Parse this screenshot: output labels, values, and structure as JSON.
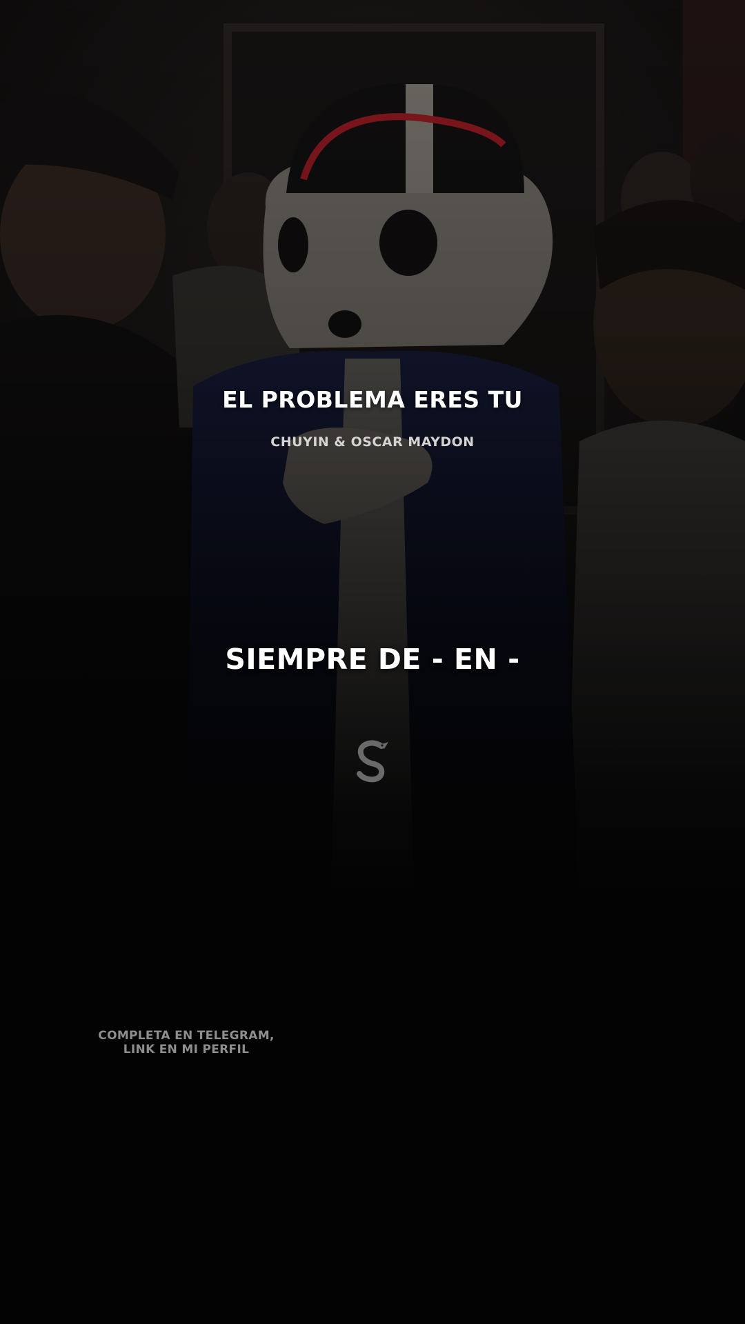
{
  "song": {
    "title": "EL PROBLEMA ERES TU",
    "artist": "CHUYIN & OSCAR MAYDON"
  },
  "lyric": {
    "current_line": "SIEMPRE DE - EN -"
  },
  "logo": {
    "icon": "snake-icon"
  },
  "promo": {
    "line1": "COMPLETA EN TELEGRAM,",
    "line2": "LINK EN MI PERFIL"
  },
  "colors": {
    "background": "#030303",
    "title_text": "#ffffff",
    "artist_text": "#d6d3d3",
    "promo_text": "#8e8e8e",
    "jacket_navy": "#141a3a",
    "cap_red": "#b8202a"
  }
}
